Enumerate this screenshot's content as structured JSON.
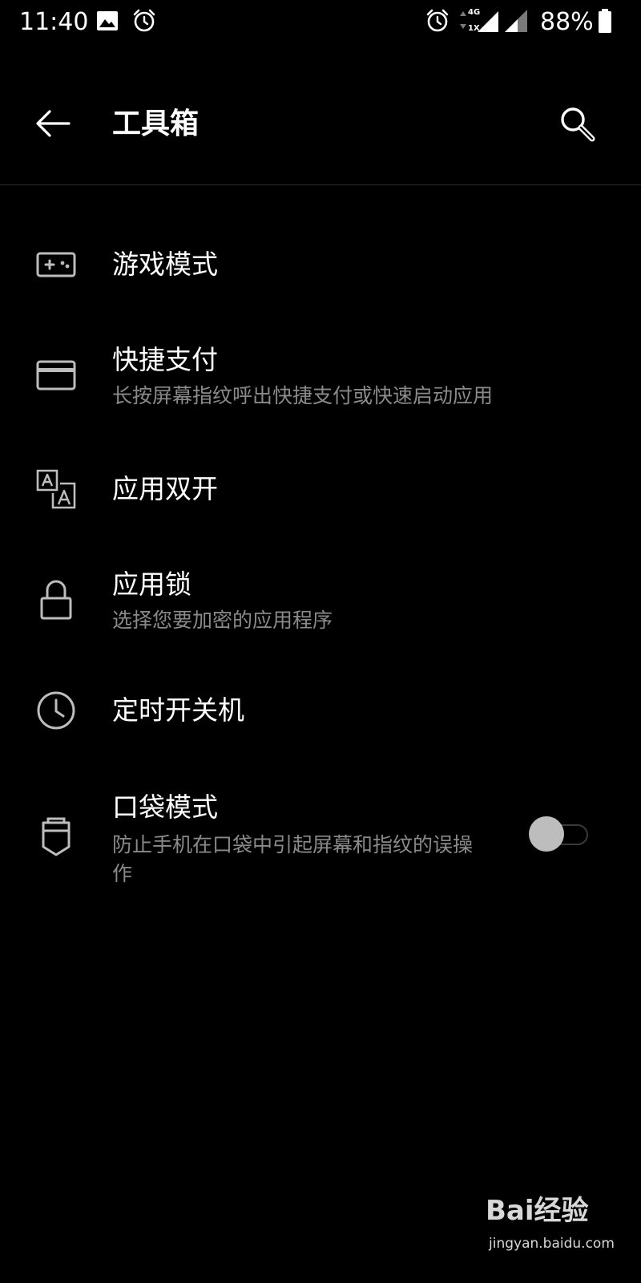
{
  "status_bar": {
    "time": "11:40",
    "battery": "88%",
    "network": "4G",
    "network_sub": "1X",
    "icons": [
      "image-icon",
      "alarm-icon",
      "alarm-icon",
      "signal-icon",
      "battery-icon"
    ]
  },
  "app_bar": {
    "title": "工具箱",
    "back_icon": "arrow-left-icon",
    "search_icon": "search-icon"
  },
  "items": [
    {
      "title": "游戏模式",
      "subtitle": "",
      "icon": "gamepad-icon"
    },
    {
      "title": "快捷支付",
      "subtitle": "长按屏幕指纹呼出快捷支付或快速启动应用",
      "icon": "credit-card-icon"
    },
    {
      "title": "应用双开",
      "subtitle": "",
      "icon": "translate-icon"
    },
    {
      "title": "应用锁",
      "subtitle": "选择您要加密的应用程序",
      "icon": "lock-icon"
    },
    {
      "title": "定时开关机",
      "subtitle": "",
      "icon": "clock-icon"
    },
    {
      "title": "口袋模式",
      "subtitle": "防止手机在口袋中引起屏幕和指纹的误操作",
      "icon": "pocket-icon",
      "toggle_on": false
    }
  ],
  "watermark": {
    "brand": "Bai经验",
    "url": "jingyan.baidu.com"
  },
  "colors": {
    "background": "#000000",
    "text_primary": "#ffffff",
    "text_secondary": "#8a8a8a",
    "icon": "#bdbdbd"
  }
}
